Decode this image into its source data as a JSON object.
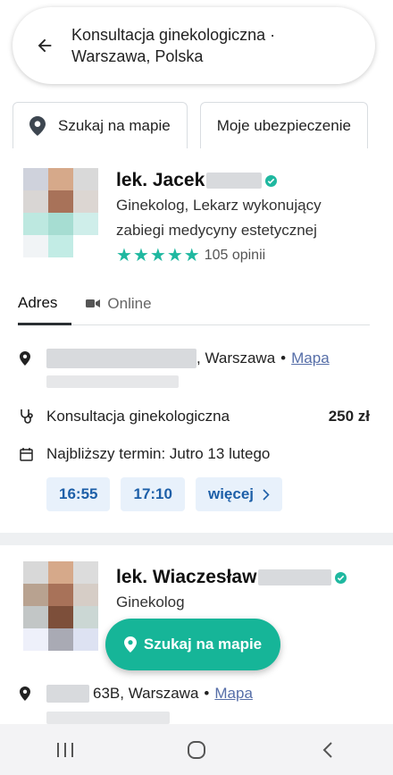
{
  "search": {
    "query": "Konsultacja ginekologiczna · Warszawa, Polska"
  },
  "chips": [
    {
      "label": "Szukaj na mapie",
      "icon": "map-pin-icon"
    },
    {
      "label": "Moje ubezpieczenie"
    }
  ],
  "doctors": [
    {
      "name": "lek. Jacek",
      "specialization_line1": "Ginekolog, Lekarz wykonujący",
      "specialization_line2": "zabiegi medycyny estetycznej",
      "rating_stars": 5,
      "reviews": "105 opinii",
      "tabs": [
        {
          "label": "Adres"
        },
        {
          "label": "Online"
        }
      ],
      "address": ", Warszawa",
      "map_link": "Mapa",
      "service": "Konsultacja ginekologiczna",
      "price": "250 zł",
      "next_date": "Najbliższy termin: Jutro 13 lutego",
      "slots": [
        "16:55",
        "17:10"
      ],
      "more_label": "więcej"
    },
    {
      "name": "lek. Wiaczesław",
      "specialization_line1": "Ginekolog",
      "address": "63B, Warszawa",
      "map_link": "Mapa"
    }
  ],
  "fab": {
    "label": "Szukaj na mapie"
  },
  "colors": {
    "accent": "#16b598",
    "slot_bg": "#e8f1fb",
    "slot_text": "#1d5fa8",
    "link": "#566ea8"
  }
}
